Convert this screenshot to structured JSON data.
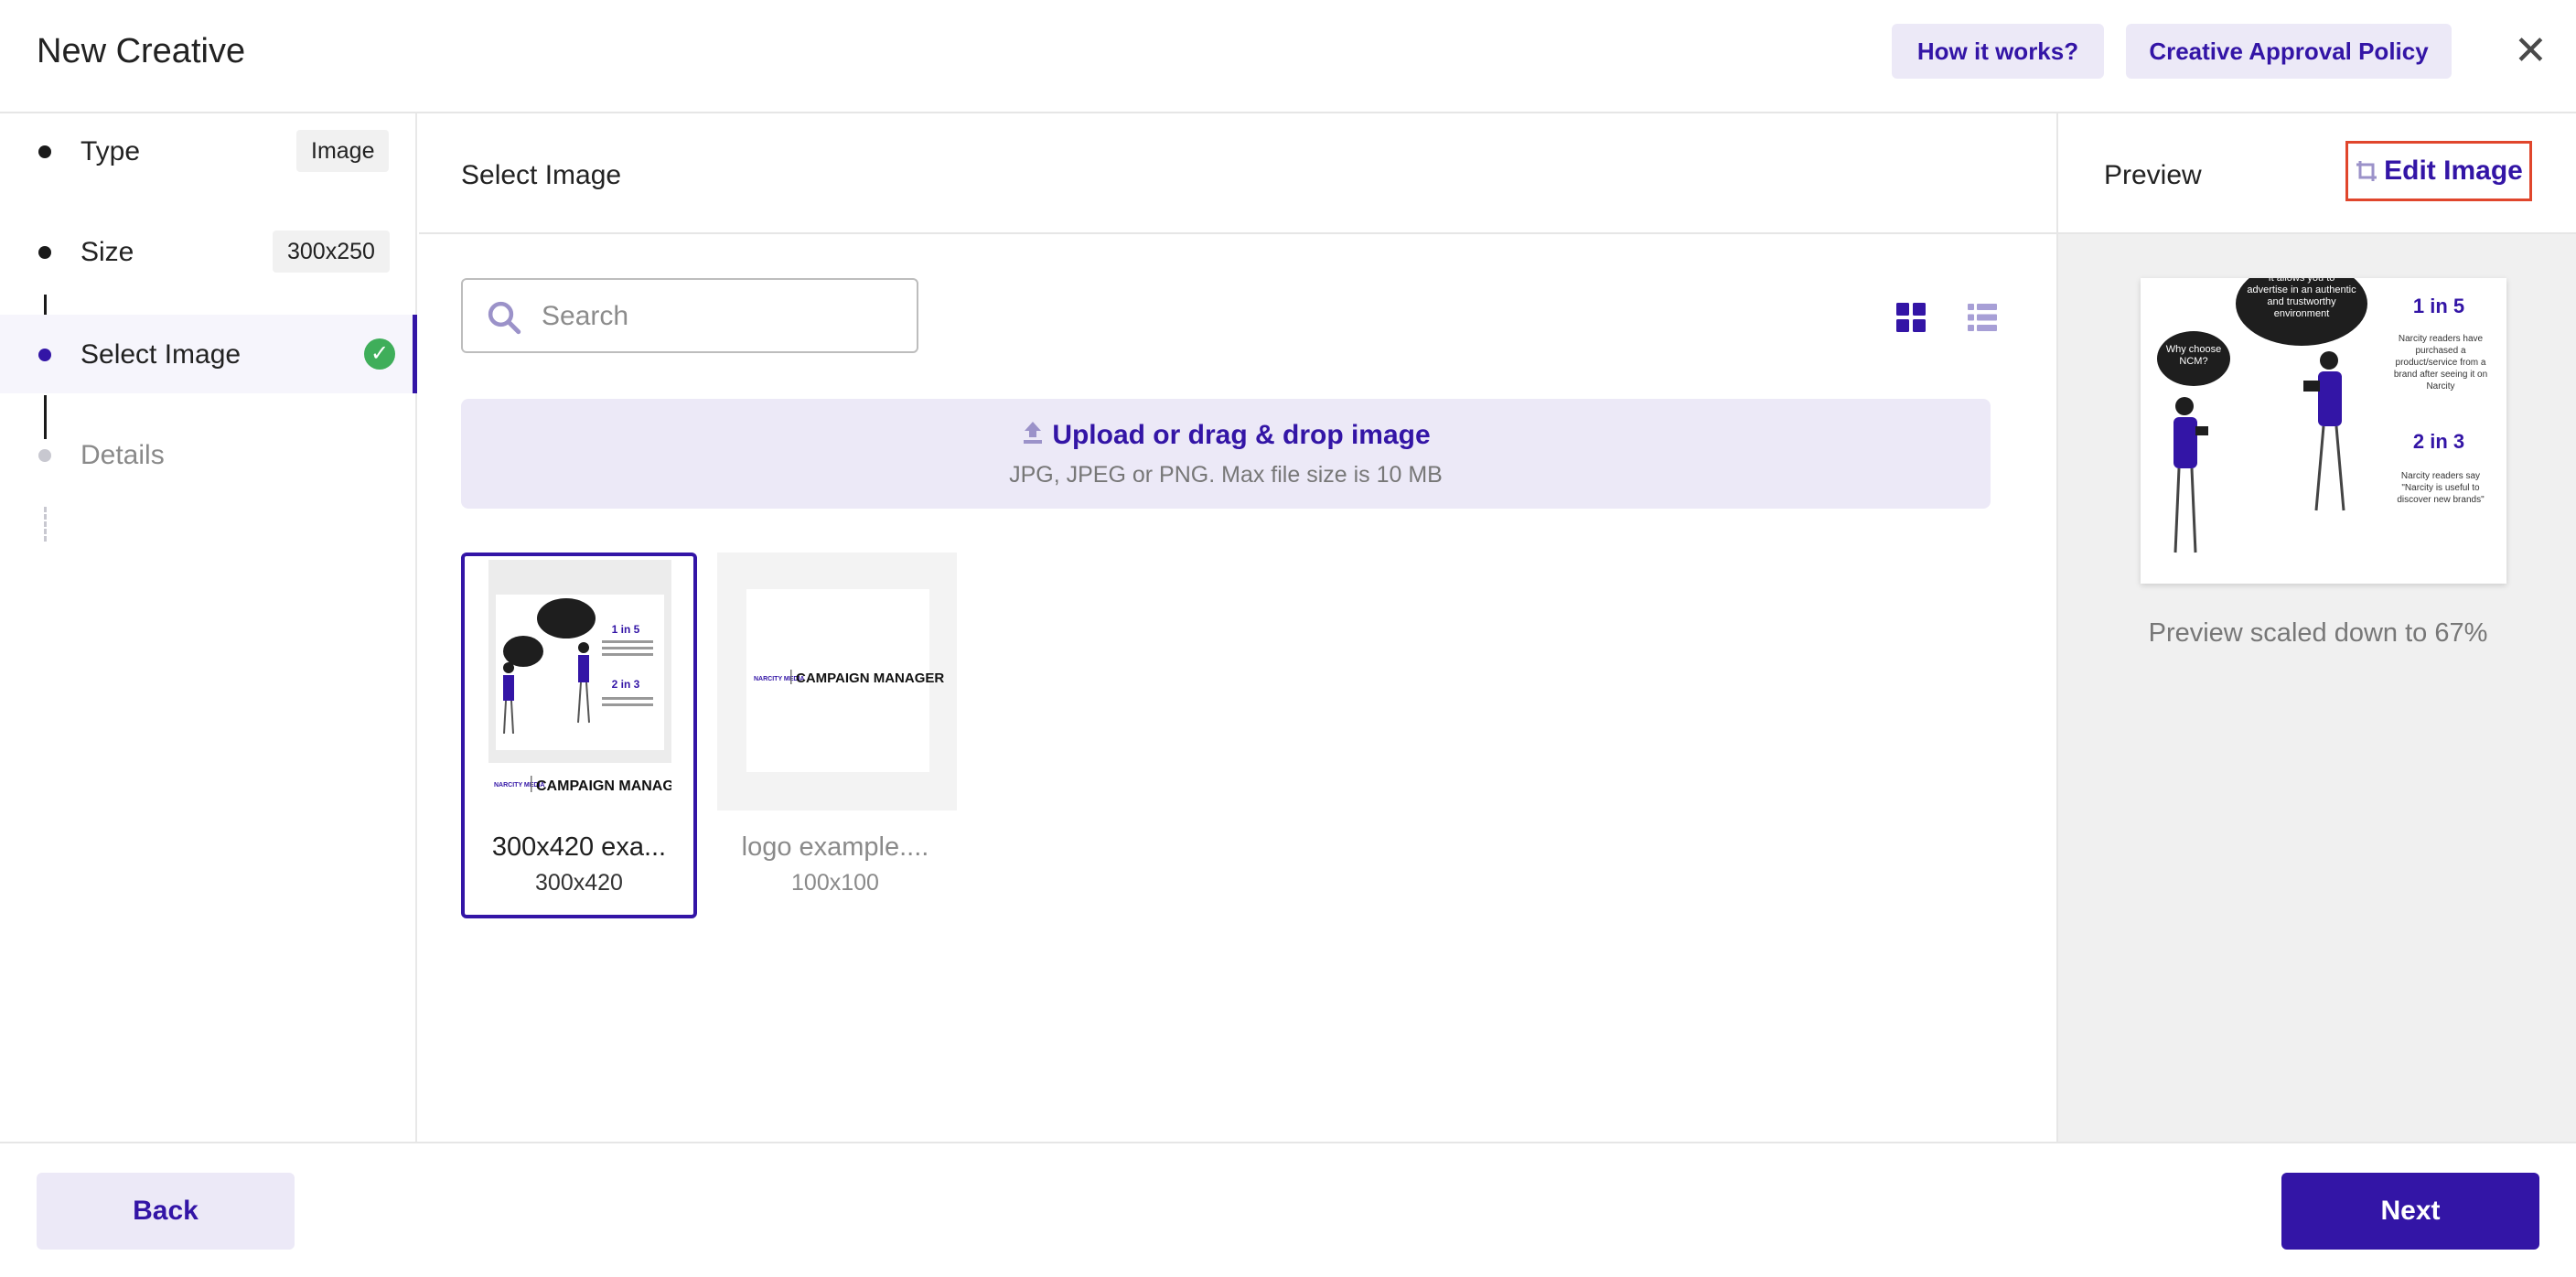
{
  "header": {
    "title": "New Creative",
    "how_it_works_label": "How it works?",
    "policy_label": "Creative Approval Policy",
    "close_icon": "close-icon"
  },
  "steps": [
    {
      "label": "Type",
      "value": "Image",
      "state": "done"
    },
    {
      "label": "Size",
      "value": "300x250",
      "state": "done"
    },
    {
      "label": "Select Image",
      "value": "",
      "state": "active"
    },
    {
      "label": "Details",
      "value": "",
      "state": "pending"
    }
  ],
  "main": {
    "title": "Select Image",
    "search": {
      "placeholder": "Search",
      "value": ""
    },
    "view_modes": [
      "grid-view-icon",
      "list-view-icon"
    ],
    "upload": {
      "label": "Upload or drag & drop image",
      "hint": "JPG, JPEG or PNG. Max file size is 10 MB"
    },
    "images": [
      {
        "name": "300x420 exa...",
        "size": "300x420",
        "selected": true,
        "brand": "NARCITY MEDIA",
        "product": "CAMPAIGN MANAGER"
      },
      {
        "name": "logo example....",
        "size": "100x100",
        "selected": false,
        "brand": "NARCITY MEDIA",
        "product": "CAMPAIGN MANAGER"
      }
    ]
  },
  "preview": {
    "title": "Preview",
    "edit_label": "Edit Image",
    "caption": "Preview scaled down to 67%",
    "ad": {
      "bubble_top": "It allows you to advertise in an authentic and trustworthy environment",
      "bubble_left": "Why choose NCM?",
      "stat1_title": "1 in 5",
      "stat1_text": "Narcity readers have purchased a product/service from a brand after seeing it on Narcity",
      "stat2_title": "2 in 3",
      "stat2_text": "Narcity readers say \"Narcity is useful to discover new brands\""
    }
  },
  "footer": {
    "back_label": "Back",
    "next_label": "Next"
  },
  "colors": {
    "accent": "#3315a6",
    "accent_soft": "#ece9f7",
    "success": "#3fae5a",
    "highlight": "#e0462c"
  }
}
